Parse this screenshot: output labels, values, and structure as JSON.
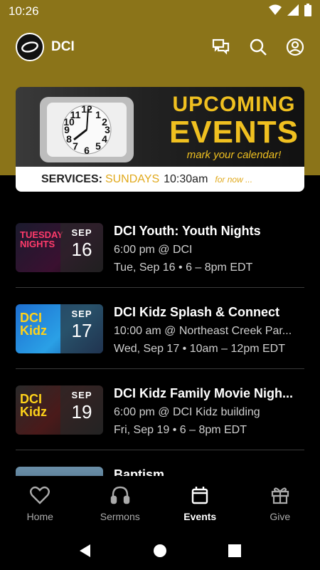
{
  "status": {
    "time": "10:26"
  },
  "app": {
    "title": "DCI"
  },
  "banner": {
    "line1": "UPCOMING",
    "line2": "EVENTS",
    "line3": "mark your calendar!",
    "services_label": "SERVICES:",
    "services_day": "SUNDAYS",
    "services_time": "10:30am",
    "services_note": "for now ..."
  },
  "events": [
    {
      "title": "DCI Youth: Youth Nights",
      "line1": "6:00 pm @ DCI",
      "line2": "Tue, Sep 16 • 6 – 8pm EDT",
      "month": "SEP",
      "day": "16",
      "art": "TUESDAY NIGHTS"
    },
    {
      "title": "DCI Kidz Splash & Connect",
      "line1": "10:00 am @ Northeast Creek Par...",
      "line2": "Wed, Sep 17 • 10am – 12pm EDT",
      "month": "SEP",
      "day": "17",
      "art": "DCI Kidz"
    },
    {
      "title": "DCI Kidz Family Movie Nigh...",
      "line1": "6:00 pm @ DCI Kidz building",
      "line2": "Fri, Sep 19 • 6 – 8pm EDT",
      "month": "SEP",
      "day": "19",
      "art": "DCI Kidz"
    },
    {
      "title": "Baptism",
      "line1": "",
      "line2": "",
      "month": "",
      "day": "",
      "art": ""
    }
  ],
  "nav": [
    {
      "label": "Home",
      "icon": "heart-icon"
    },
    {
      "label": "Sermons",
      "icon": "headphones-icon"
    },
    {
      "label": "Events",
      "icon": "calendar-icon"
    },
    {
      "label": "Give",
      "icon": "gift-icon"
    }
  ],
  "colors": {
    "gold": "#8b7419",
    "banner_accent": "#f0c020"
  }
}
